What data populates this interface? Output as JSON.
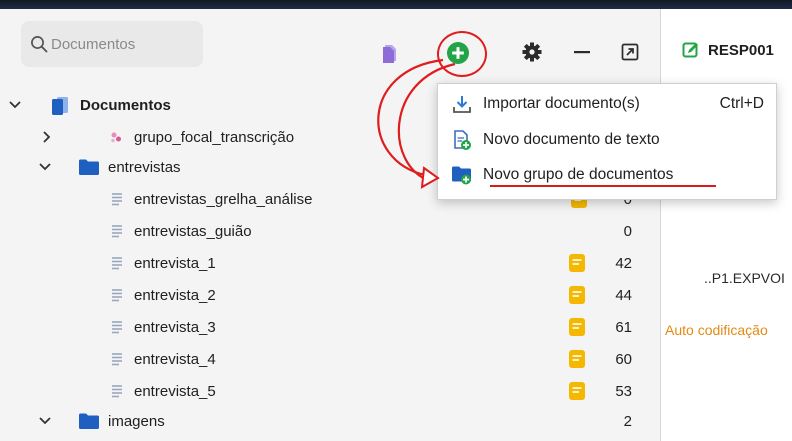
{
  "search": {
    "placeholder": "Documentos"
  },
  "header": {
    "doc_code": "RESP001"
  },
  "tree": {
    "root": {
      "label": "Documentos"
    },
    "items": [
      {
        "label": "grupo_focal_transcrição",
        "count": ""
      },
      {
        "label": "entrevistas",
        "count": ""
      },
      {
        "label": "entrevistas_grelha_análise",
        "count": "0"
      },
      {
        "label": "entrevistas_guião",
        "count": "0"
      },
      {
        "label": "entrevista_1",
        "count": "42"
      },
      {
        "label": "entrevista_2",
        "count": "44"
      },
      {
        "label": "entrevista_3",
        "count": "61"
      },
      {
        "label": "entrevista_4",
        "count": "60"
      },
      {
        "label": "entrevista_5",
        "count": "53"
      },
      {
        "label": "imagens",
        "count": "2"
      }
    ]
  },
  "menu": {
    "items": [
      {
        "label": "Importar documento(s)",
        "shortcut": "Ctrl+D"
      },
      {
        "label": "Novo documento de texto",
        "shortcut": ""
      },
      {
        "label": "Novo grupo de documentos",
        "shortcut": ""
      }
    ]
  },
  "right_panel": {
    "code_text": "..P1.EXPVOI",
    "auto_label": "Auto codificação"
  },
  "colors": {
    "accent_green": "#22a447",
    "folder_blue": "#1f5fbf",
    "doc_purple": "#8e6bd6",
    "note_yellow": "#f5b800",
    "highlight_red": "#e01d1d",
    "auto_orange": "#e48a14"
  }
}
